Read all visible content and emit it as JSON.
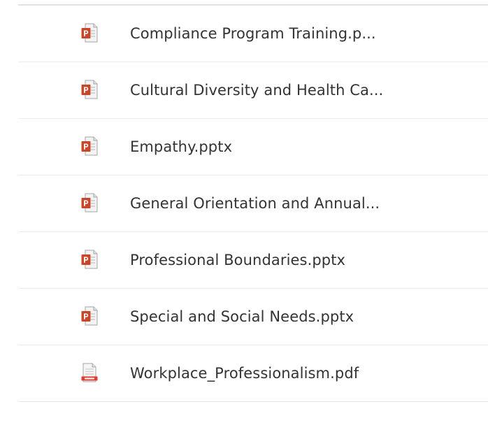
{
  "files": [
    {
      "name": "Compliance Program Training.p...",
      "icon": "powerpoint-file-icon"
    },
    {
      "name": "Cultural Diversity and Health Ca...",
      "icon": "powerpoint-file-icon"
    },
    {
      "name": "Empathy.pptx",
      "icon": "powerpoint-file-icon"
    },
    {
      "name": "General Orientation and Annual...",
      "icon": "powerpoint-file-icon"
    },
    {
      "name": "Professional Boundaries.pptx",
      "icon": "powerpoint-file-icon"
    },
    {
      "name": "Special and Social Needs.pptx",
      "icon": "powerpoint-file-icon"
    },
    {
      "name": "Workplace_Professionalism.pdf",
      "icon": "pdf-file-icon"
    }
  ],
  "colors": {
    "powerpoint_accent": "#c8472b",
    "pdf_accent": "#e03c31",
    "text": "#333333",
    "divider": "#ececec"
  }
}
